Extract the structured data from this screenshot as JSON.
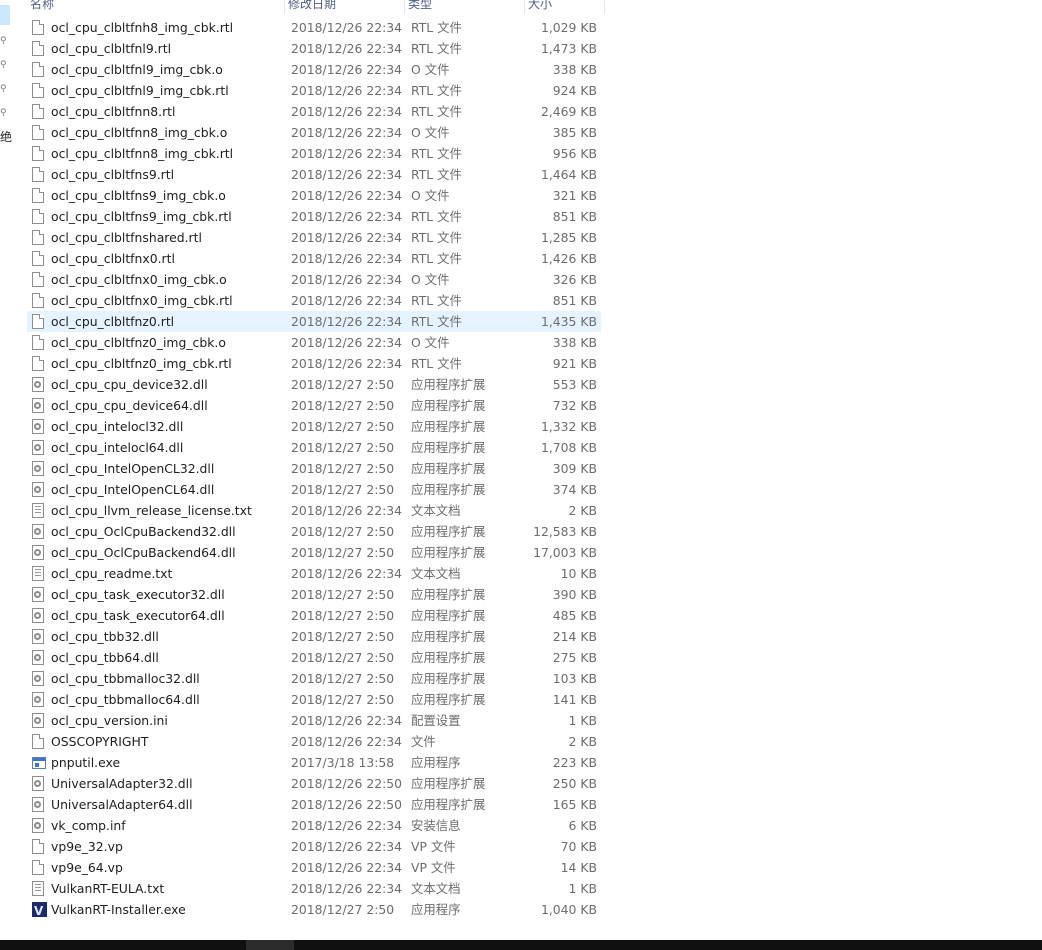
{
  "columns": {
    "name": "名称",
    "date": "修改日期",
    "type": "类型",
    "size": "大小"
  },
  "nav_partial_label": "绝",
  "files": [
    {
      "name": "ocl_cpu_clbltfnh8_img_cbk.rtl",
      "date": "2018/12/26 22:34",
      "type": "RTL 文件",
      "size": "1,029 KB",
      "icon": "file-icon"
    },
    {
      "name": "ocl_cpu_clbltfnl9.rtl",
      "date": "2018/12/26 22:34",
      "type": "RTL 文件",
      "size": "1,473 KB",
      "icon": "file-icon"
    },
    {
      "name": "ocl_cpu_clbltfnl9_img_cbk.o",
      "date": "2018/12/26 22:34",
      "type": "O 文件",
      "size": "338 KB",
      "icon": "file-icon"
    },
    {
      "name": "ocl_cpu_clbltfnl9_img_cbk.rtl",
      "date": "2018/12/26 22:34",
      "type": "RTL 文件",
      "size": "924 KB",
      "icon": "file-icon"
    },
    {
      "name": "ocl_cpu_clbltfnn8.rtl",
      "date": "2018/12/26 22:34",
      "type": "RTL 文件",
      "size": "2,469 KB",
      "icon": "file-icon"
    },
    {
      "name": "ocl_cpu_clbltfnn8_img_cbk.o",
      "date": "2018/12/26 22:34",
      "type": "O 文件",
      "size": "385 KB",
      "icon": "file-icon"
    },
    {
      "name": "ocl_cpu_clbltfnn8_img_cbk.rtl",
      "date": "2018/12/26 22:34",
      "type": "RTL 文件",
      "size": "956 KB",
      "icon": "file-icon"
    },
    {
      "name": "ocl_cpu_clbltfns9.rtl",
      "date": "2018/12/26 22:34",
      "type": "RTL 文件",
      "size": "1,464 KB",
      "icon": "file-icon"
    },
    {
      "name": "ocl_cpu_clbltfns9_img_cbk.o",
      "date": "2018/12/26 22:34",
      "type": "O 文件",
      "size": "321 KB",
      "icon": "file-icon"
    },
    {
      "name": "ocl_cpu_clbltfns9_img_cbk.rtl",
      "date": "2018/12/26 22:34",
      "type": "RTL 文件",
      "size": "851 KB",
      "icon": "file-icon"
    },
    {
      "name": "ocl_cpu_clbltfnshared.rtl",
      "date": "2018/12/26 22:34",
      "type": "RTL 文件",
      "size": "1,285 KB",
      "icon": "file-icon"
    },
    {
      "name": "ocl_cpu_clbltfnx0.rtl",
      "date": "2018/12/26 22:34",
      "type": "RTL 文件",
      "size": "1,426 KB",
      "icon": "file-icon"
    },
    {
      "name": "ocl_cpu_clbltfnx0_img_cbk.o",
      "date": "2018/12/26 22:34",
      "type": "O 文件",
      "size": "326 KB",
      "icon": "file-icon"
    },
    {
      "name": "ocl_cpu_clbltfnx0_img_cbk.rtl",
      "date": "2018/12/26 22:34",
      "type": "RTL 文件",
      "size": "851 KB",
      "icon": "file-icon"
    },
    {
      "name": "ocl_cpu_clbltfnz0.rtl",
      "date": "2018/12/26 22:34",
      "type": "RTL 文件",
      "size": "1,435 KB",
      "icon": "file-icon",
      "selected": true
    },
    {
      "name": "ocl_cpu_clbltfnz0_img_cbk.o",
      "date": "2018/12/26 22:34",
      "type": "O 文件",
      "size": "338 KB",
      "icon": "file-icon"
    },
    {
      "name": "ocl_cpu_clbltfnz0_img_cbk.rtl",
      "date": "2018/12/26 22:34",
      "type": "RTL 文件",
      "size": "921 KB",
      "icon": "file-icon"
    },
    {
      "name": "ocl_cpu_cpu_device32.dll",
      "date": "2018/12/27 2:50",
      "type": "应用程序扩展",
      "size": "553 KB",
      "icon": "dll-icon"
    },
    {
      "name": "ocl_cpu_cpu_device64.dll",
      "date": "2018/12/27 2:50",
      "type": "应用程序扩展",
      "size": "732 KB",
      "icon": "dll-icon"
    },
    {
      "name": "ocl_cpu_intelocl32.dll",
      "date": "2018/12/27 2:50",
      "type": "应用程序扩展",
      "size": "1,332 KB",
      "icon": "dll-icon"
    },
    {
      "name": "ocl_cpu_intelocl64.dll",
      "date": "2018/12/27 2:50",
      "type": "应用程序扩展",
      "size": "1,708 KB",
      "icon": "dll-icon"
    },
    {
      "name": "ocl_cpu_IntelOpenCL32.dll",
      "date": "2018/12/27 2:50",
      "type": "应用程序扩展",
      "size": "309 KB",
      "icon": "dll-icon"
    },
    {
      "name": "ocl_cpu_IntelOpenCL64.dll",
      "date": "2018/12/27 2:50",
      "type": "应用程序扩展",
      "size": "374 KB",
      "icon": "dll-icon"
    },
    {
      "name": "ocl_cpu_llvm_release_license.txt",
      "date": "2018/12/26 22:34",
      "type": "文本文档",
      "size": "2 KB",
      "icon": "text-file-icon"
    },
    {
      "name": "ocl_cpu_OclCpuBackend32.dll",
      "date": "2018/12/27 2:50",
      "type": "应用程序扩展",
      "size": "12,583 KB",
      "icon": "dll-icon"
    },
    {
      "name": "ocl_cpu_OclCpuBackend64.dll",
      "date": "2018/12/27 2:50",
      "type": "应用程序扩展",
      "size": "17,003 KB",
      "icon": "dll-icon"
    },
    {
      "name": "ocl_cpu_readme.txt",
      "date": "2018/12/26 22:34",
      "type": "文本文档",
      "size": "10 KB",
      "icon": "text-file-icon"
    },
    {
      "name": "ocl_cpu_task_executor32.dll",
      "date": "2018/12/27 2:50",
      "type": "应用程序扩展",
      "size": "390 KB",
      "icon": "dll-icon"
    },
    {
      "name": "ocl_cpu_task_executor64.dll",
      "date": "2018/12/27 2:50",
      "type": "应用程序扩展",
      "size": "485 KB",
      "icon": "dll-icon"
    },
    {
      "name": "ocl_cpu_tbb32.dll",
      "date": "2018/12/27 2:50",
      "type": "应用程序扩展",
      "size": "214 KB",
      "icon": "dll-icon"
    },
    {
      "name": "ocl_cpu_tbb64.dll",
      "date": "2018/12/27 2:50",
      "type": "应用程序扩展",
      "size": "275 KB",
      "icon": "dll-icon"
    },
    {
      "name": "ocl_cpu_tbbmalloc32.dll",
      "date": "2018/12/27 2:50",
      "type": "应用程序扩展",
      "size": "103 KB",
      "icon": "dll-icon"
    },
    {
      "name": "ocl_cpu_tbbmalloc64.dll",
      "date": "2018/12/27 2:50",
      "type": "应用程序扩展",
      "size": "141 KB",
      "icon": "dll-icon"
    },
    {
      "name": "ocl_cpu_version.ini",
      "date": "2018/12/26 22:34",
      "type": "配置设置",
      "size": "1 KB",
      "icon": "settings-file-icon"
    },
    {
      "name": "OSSCOPYRIGHT",
      "date": "2018/12/26 22:34",
      "type": "文件",
      "size": "2 KB",
      "icon": "file-icon"
    },
    {
      "name": "pnputil.exe",
      "date": "2017/3/18 13:58",
      "type": "应用程序",
      "size": "223 KB",
      "icon": "exe-icon"
    },
    {
      "name": "UniversalAdapter32.dll",
      "date": "2018/12/26 22:50",
      "type": "应用程序扩展",
      "size": "250 KB",
      "icon": "dll-icon"
    },
    {
      "name": "UniversalAdapter64.dll",
      "date": "2018/12/26 22:50",
      "type": "应用程序扩展",
      "size": "165 KB",
      "icon": "dll-icon"
    },
    {
      "name": "vk_comp.inf",
      "date": "2018/12/26 22:34",
      "type": "安装信息",
      "size": "6 KB",
      "icon": "settings-file-icon"
    },
    {
      "name": "vp9e_32.vp",
      "date": "2018/12/26 22:34",
      "type": "VP 文件",
      "size": "70 KB",
      "icon": "file-icon"
    },
    {
      "name": "vp9e_64.vp",
      "date": "2018/12/26 22:34",
      "type": "VP 文件",
      "size": "14 KB",
      "icon": "file-icon"
    },
    {
      "name": "VulkanRT-EULA.txt",
      "date": "2018/12/26 22:34",
      "type": "文本文档",
      "size": "1 KB",
      "icon": "text-file-icon"
    },
    {
      "name": "VulkanRT-Installer.exe",
      "date": "2018/12/27 2:50",
      "type": "应用程序",
      "size": "1,040 KB",
      "icon": "vulkan-app-icon"
    }
  ]
}
